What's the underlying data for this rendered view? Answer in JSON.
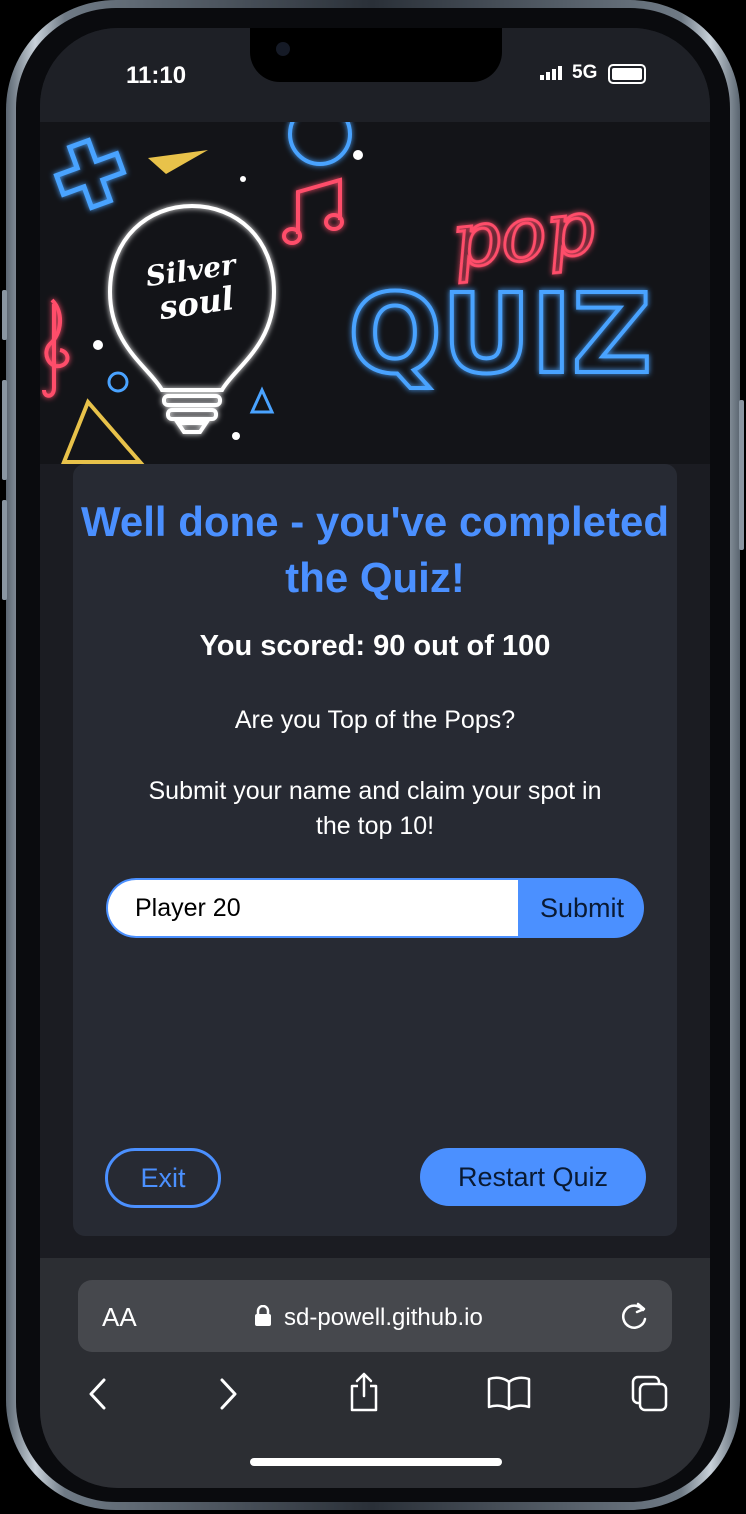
{
  "status_bar": {
    "time": "11:10",
    "network": "5G"
  },
  "banner": {
    "logo_line1": "Silver",
    "logo_line2": "soul",
    "title_small": "pop",
    "title_big": "QUIZ"
  },
  "result": {
    "heading": "Well done - you've completed the Quiz!",
    "score": "You scored: 90 out of 100",
    "question": "Are you Top of the Pops?",
    "prompt": "Submit your name and claim your spot in the top 10!"
  },
  "form": {
    "name_value": "Player 20",
    "submit_label": "Submit"
  },
  "actions": {
    "exit_label": "Exit",
    "restart_label": "Restart Quiz"
  },
  "browser": {
    "text_size_label": "AA",
    "url": "sd-powell.github.io"
  },
  "colors": {
    "accent": "#4b90ff",
    "card": "#272a33",
    "background": "#1b1c22"
  }
}
